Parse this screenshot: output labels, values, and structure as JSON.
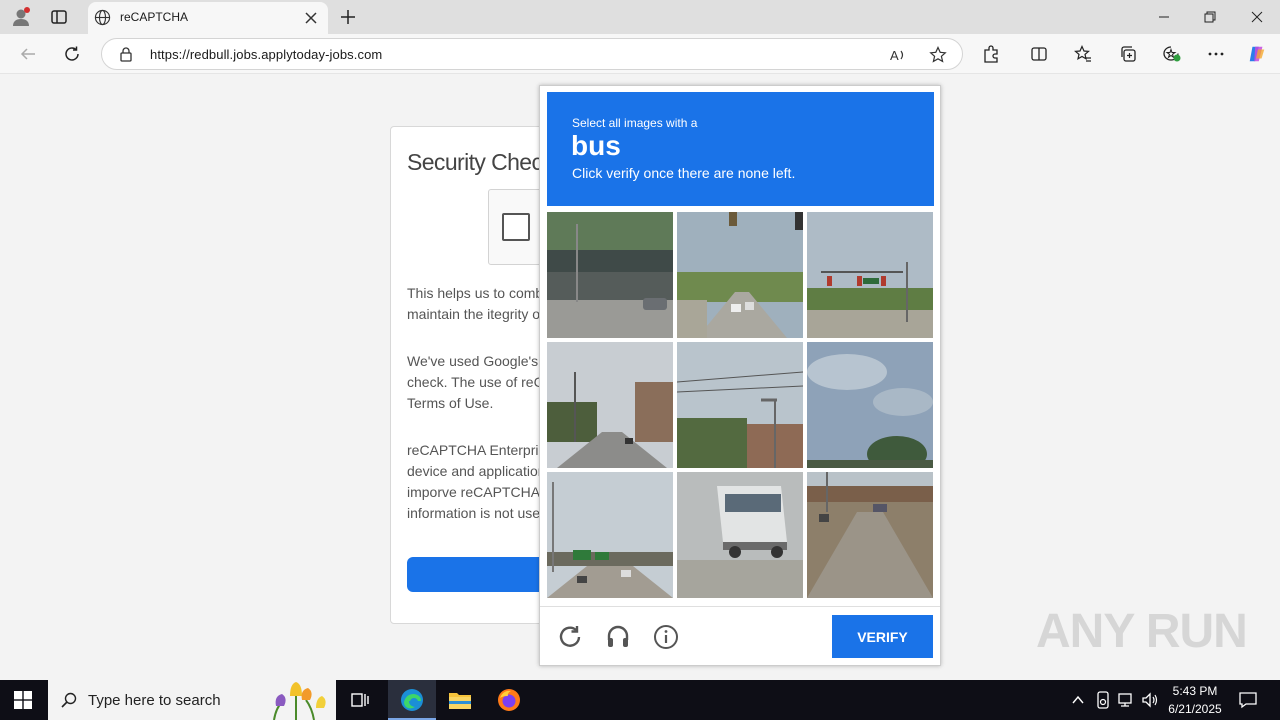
{
  "browser": {
    "tab_title": "reCAPTCHA",
    "url": "https://redbull.jobs.applytoday-jobs.com"
  },
  "page": {
    "card_title": "Security Chec",
    "paragraph_1": "This helps us to comba\nmaintain the itegrity of",
    "paragraph_2": "We've used Google's r\ncheck. The use of reC\nTerms of Use.",
    "paragraph_3": "reCAPTCHA Enterpris\ndevice and application\nimporve reCAPTCHA I\ninformation is not used"
  },
  "challenge": {
    "instruction": "Select all images with a",
    "target": "bus",
    "hint": "Click verify once there are none left.",
    "verify_label": "VERIFY",
    "tiles": [
      {
        "scene": "overpass"
      },
      {
        "scene": "highway-cars"
      },
      {
        "scene": "traffic-light-trees"
      },
      {
        "scene": "street-buildings"
      },
      {
        "scene": "streetlight-trees"
      },
      {
        "scene": "sky-tree"
      },
      {
        "scene": "highway-signs"
      },
      {
        "scene": "bus"
      },
      {
        "scene": "road-car"
      }
    ]
  },
  "watermark": "ANY RUN",
  "taskbar": {
    "search_placeholder": "Type here to search",
    "time": "5:43 PM",
    "date": "6/21/2025"
  }
}
